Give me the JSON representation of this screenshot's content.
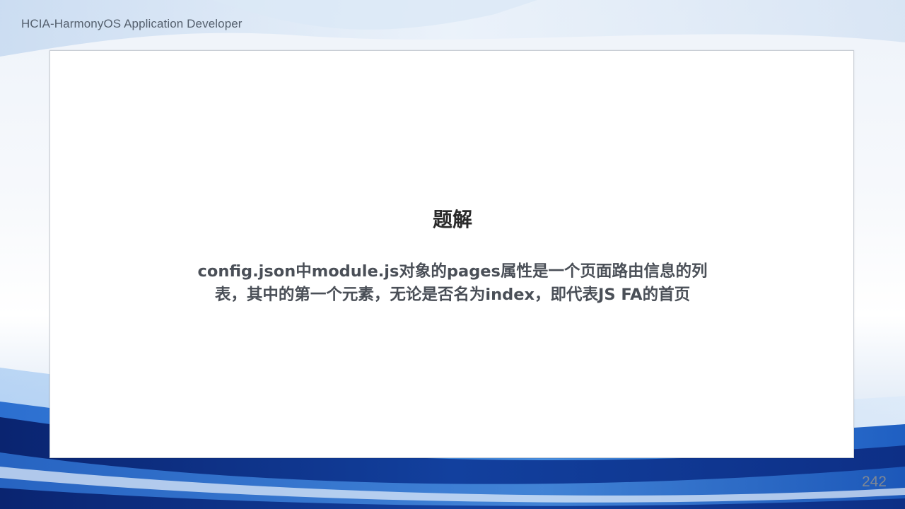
{
  "header": {
    "course_title": "HCIA-HarmonyOS Application Developer"
  },
  "card": {
    "title": "题解",
    "body_lines": [
      "config.json中module.js对象的pages属性是一个页面路由信息的列",
      "表，其中的第一个元素，无论是否名为index，即代表JS FA的首页"
    ]
  },
  "footer": {
    "page_number": "242"
  },
  "colors": {
    "wave_dark": "#0d2f86",
    "wave_mid": "#1f5fc2",
    "wave_light": "#5fa0e3",
    "text_body": "#4a4f57",
    "text_title": "#2a2a2a"
  }
}
